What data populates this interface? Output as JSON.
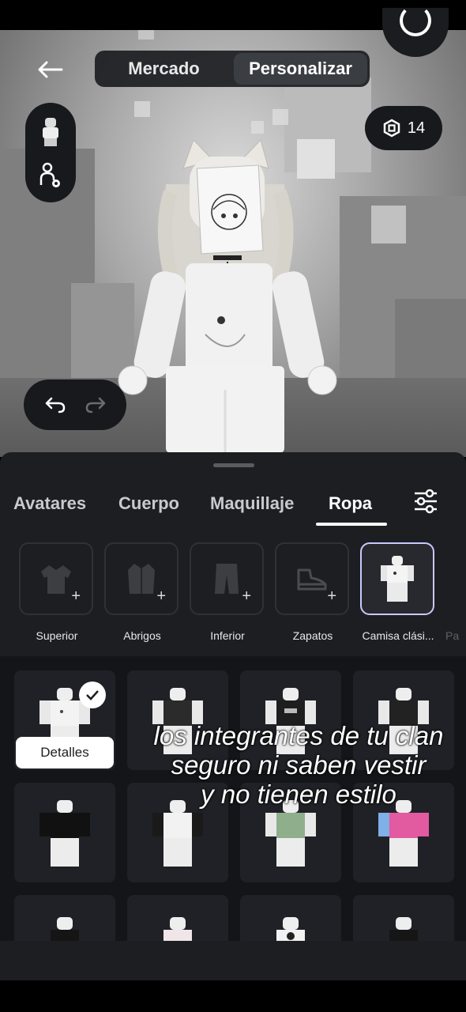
{
  "header": {
    "segments": [
      {
        "label": "Mercado",
        "active": false
      },
      {
        "label": "Personalizar",
        "active": true
      }
    ],
    "robux_count": "14"
  },
  "tabs": [
    {
      "label": "Avatares",
      "active": false
    },
    {
      "label": "Cuerpo",
      "active": false
    },
    {
      "label": "Maquillaje",
      "active": false
    },
    {
      "label": "Ropa",
      "active": true
    }
  ],
  "categories": [
    {
      "label": "Superior",
      "icon": "jacket-icon",
      "selected": false
    },
    {
      "label": "Abrigos",
      "icon": "coat-icon",
      "selected": false
    },
    {
      "label": "Inferior",
      "icon": "pants-icon",
      "selected": false
    },
    {
      "label": "Zapatos",
      "icon": "shoe-icon",
      "selected": false
    },
    {
      "label": "Camisa clási...",
      "icon": "classic-shirt-thumbnail",
      "selected": true
    },
    {
      "label": "Pa",
      "icon": "",
      "selected": false
    }
  ],
  "items_popup": {
    "details_label": "Detalles"
  },
  "overlay_caption": {
    "line1": "los integrantes de tu clan",
    "line2": "seguro ni saben vestir",
    "line3": "y no tienen estilo"
  },
  "colors": {
    "sheet_bg": "#1d1e22",
    "selected_border": "#c9c9ff",
    "accent": "#ffffff"
  }
}
